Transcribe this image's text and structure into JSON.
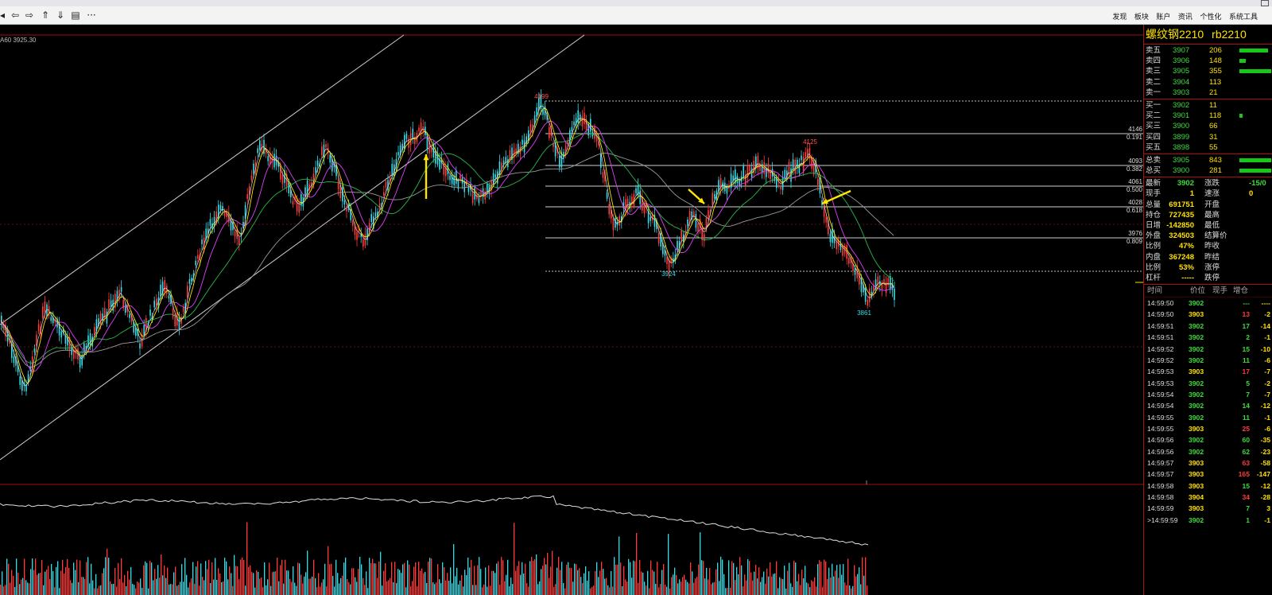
{
  "toolbar": {
    "icons": [
      "back-arrow-icon",
      "left-arrow-icon",
      "right-arrow-icon",
      "double-up-icon",
      "double-down-icon",
      "layout-icon",
      "more-icon"
    ],
    "more_label": "···",
    "menu": [
      "发现",
      "板块",
      "账户",
      "资讯",
      "个性化",
      "系统工具"
    ]
  },
  "chart": {
    "ma_label": "A60 3925.30",
    "peak_high": "4199",
    "peak_mid": "4125",
    "low_1": "3924",
    "low_2": "3861",
    "fib_levels": [
      {
        "price": "4146",
        "ratio": "0.191"
      },
      {
        "price": "4093",
        "ratio": "0.382"
      },
      {
        "price": "4061",
        "ratio": "0.500"
      },
      {
        "price": "4028",
        "ratio": "0.618"
      },
      {
        "price": "3976",
        "ratio": "0.809"
      }
    ],
    "colors": {
      "up": "#ff3b3b",
      "down": "#35dde8",
      "ma_white": "#dddddd",
      "ma_yellow": "#ffe100",
      "ma_magenta": "#e040fb",
      "ma_green": "#29b84a",
      "arrow": "#ffe600",
      "grid": "#a11111"
    }
  },
  "panel": {
    "title_cn": "螺纹钢2210",
    "title_code": "rb2210",
    "asks": [
      {
        "label": "卖五",
        "price": "3907",
        "vol": "206",
        "bar": 0.9
      },
      {
        "label": "卖四",
        "price": "3906",
        "vol": "148",
        "bar": 0.2
      },
      {
        "label": "卖三",
        "price": "3905",
        "vol": "355",
        "bar": 1.0
      },
      {
        "label": "卖二",
        "price": "3904",
        "vol": "113",
        "bar": 0
      },
      {
        "label": "卖一",
        "price": "3903",
        "vol": "21",
        "bar": 0
      }
    ],
    "bids": [
      {
        "label": "买一",
        "price": "3902",
        "vol": "11",
        "bar": 0
      },
      {
        "label": "买二",
        "price": "3901",
        "vol": "118",
        "bar": 0.1
      },
      {
        "label": "买三",
        "price": "3900",
        "vol": "66",
        "bar": 0
      },
      {
        "label": "买四",
        "price": "3899",
        "vol": "31",
        "bar": 0
      },
      {
        "label": "买五",
        "price": "3898",
        "vol": "55",
        "bar": 0
      }
    ],
    "totals": [
      {
        "label": "总卖",
        "price": "3905",
        "vol": "843",
        "bar": 1.0
      },
      {
        "label": "总买",
        "price": "3900",
        "vol": "281",
        "bar": 1.0
      }
    ],
    "stats": [
      {
        "l1": "最新",
        "v1": "3902",
        "c1": "green",
        "l2": "涨跌",
        "v2": "-15/0",
        "c2": "green"
      },
      {
        "l1": "现手",
        "v1": "1",
        "c1": "yellow",
        "l2": "速涨",
        "v2": "0",
        "c2": "yellow"
      },
      {
        "l1": "总量",
        "v1": "691751",
        "c1": "yellow",
        "l2": "开盘",
        "v2": "",
        "c2": "yellow"
      },
      {
        "l1": "持仓",
        "v1": "727435",
        "c1": "yellow",
        "l2": "最高",
        "v2": "",
        "c2": "yellow"
      },
      {
        "l1": "日增",
        "v1": "-142850",
        "c1": "yellow",
        "l2": "最低",
        "v2": "",
        "c2": "yellow"
      },
      {
        "l1": "外盘",
        "v1": "324503",
        "c1": "yellow",
        "l2": "结算价",
        "v2": "",
        "c2": "yellow"
      },
      {
        "l1": "比例",
        "v1": "47%",
        "c1": "yellow",
        "l2": "昨收",
        "v2": "",
        "c2": "yellow"
      },
      {
        "l1": "内盘",
        "v1": "367248",
        "c1": "yellow",
        "l2": "昨结",
        "v2": "",
        "c2": "yellow"
      },
      {
        "l1": "比例",
        "v1": "53%",
        "c1": "yellow",
        "l2": "涨停",
        "v2": "",
        "c2": "yellow"
      },
      {
        "l1": "杠杆",
        "v1": "-----",
        "c1": "yellow",
        "l2": "跌停",
        "v2": "",
        "c2": "yellow"
      }
    ],
    "tick_header": {
      "time": "时间",
      "price": "价位",
      "vol": "现手",
      "oi": "增仓"
    },
    "ticks": [
      {
        "t": "14:59:50",
        "p": "3902",
        "pc": "green",
        "v": "---",
        "vc": "green",
        "o": "----",
        "oc": "yellow"
      },
      {
        "t": "14:59:50",
        "p": "3903",
        "pc": "yellow",
        "v": "13",
        "vc": "red",
        "o": "-2",
        "oc": "yellow"
      },
      {
        "t": "14:59:51",
        "p": "3902",
        "pc": "green",
        "v": "17",
        "vc": "green",
        "o": "-14",
        "oc": "yellow"
      },
      {
        "t": "14:59:51",
        "p": "3902",
        "pc": "green",
        "v": "2",
        "vc": "green",
        "o": "-1",
        "oc": "yellow"
      },
      {
        "t": "14:59:52",
        "p": "3902",
        "pc": "green",
        "v": "15",
        "vc": "green",
        "o": "-10",
        "oc": "yellow"
      },
      {
        "t": "14:59:52",
        "p": "3902",
        "pc": "green",
        "v": "11",
        "vc": "green",
        "o": "-6",
        "oc": "yellow"
      },
      {
        "t": "14:59:53",
        "p": "3903",
        "pc": "yellow",
        "v": "17",
        "vc": "red",
        "o": "-7",
        "oc": "yellow"
      },
      {
        "t": "14:59:53",
        "p": "3902",
        "pc": "green",
        "v": "5",
        "vc": "green",
        "o": "-2",
        "oc": "yellow"
      },
      {
        "t": "14:59:54",
        "p": "3902",
        "pc": "green",
        "v": "7",
        "vc": "green",
        "o": "-7",
        "oc": "yellow"
      },
      {
        "t": "14:59:54",
        "p": "3902",
        "pc": "green",
        "v": "14",
        "vc": "green",
        "o": "-12",
        "oc": "yellow"
      },
      {
        "t": "14:59:55",
        "p": "3902",
        "pc": "green",
        "v": "11",
        "vc": "green",
        "o": "-1",
        "oc": "yellow"
      },
      {
        "t": "14:59:55",
        "p": "3903",
        "pc": "yellow",
        "v": "25",
        "vc": "red",
        "o": "-6",
        "oc": "yellow"
      },
      {
        "t": "14:59:56",
        "p": "3902",
        "pc": "green",
        "v": "60",
        "vc": "green",
        "o": "-35",
        "oc": "yellow"
      },
      {
        "t": "14:59:56",
        "p": "3902",
        "pc": "green",
        "v": "62",
        "vc": "green",
        "o": "-23",
        "oc": "yellow"
      },
      {
        "t": "14:59:57",
        "p": "3903",
        "pc": "yellow",
        "v": "63",
        "vc": "red",
        "o": "-58",
        "oc": "yellow"
      },
      {
        "t": "14:59:57",
        "p": "3903",
        "pc": "yellow",
        "v": "165",
        "vc": "red",
        "o": "-147",
        "oc": "yellow"
      },
      {
        "t": "14:59:58",
        "p": "3903",
        "pc": "yellow",
        "v": "15",
        "vc": "green",
        "o": "-12",
        "oc": "yellow"
      },
      {
        "t": "14:59:58",
        "p": "3904",
        "pc": "yellow",
        "v": "34",
        "vc": "red",
        "o": "-28",
        "oc": "yellow"
      },
      {
        "t": "14:59:59",
        "p": "3903",
        "pc": "yellow",
        "v": "7",
        "vc": "green",
        "o": "3",
        "oc": "yellow"
      },
      {
        "t": ">14:59:59",
        "p": "3902",
        "pc": "green",
        "v": "1",
        "vc": "green",
        "o": "-1",
        "oc": "yellow"
      }
    ]
  }
}
